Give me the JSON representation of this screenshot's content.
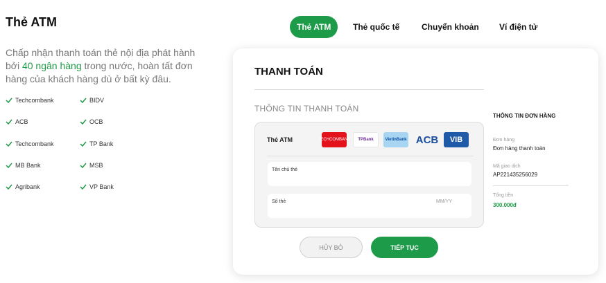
{
  "left": {
    "title": "Thẻ ATM",
    "intro_part1": "Chấp nhận thanh toán thẻ nội địa phát hành bởi ",
    "intro_highlight": "40 ngân hàng",
    "intro_part2": " trong nước, hoàn tất đơn hàng của khách hàng dù ở bất kỳ đâu.",
    "banks": [
      "Techcombank",
      "BIDV",
      "ACB",
      "OCB",
      "Techcombank",
      "TP Bank",
      "MB Bank",
      "MSB",
      "Agribank",
      "VP Bank"
    ]
  },
  "tabs": [
    "Thẻ ATM",
    "Thẻ quốc tế",
    "Chuyển khoản",
    "Ví điện tử"
  ],
  "payment": {
    "title": "THANH TOÁN",
    "info_title": "THÔNG TIN THANH TOÁN",
    "card_type_label": "Thẻ ATM",
    "bank_logos": [
      "TECHCOMBANK",
      "TPBank",
      "VietinBank",
      "ACB",
      "VIB"
    ],
    "cardholder_label": "Tên chủ thẻ",
    "card_number_label": "Số thẻ",
    "expiry_placeholder": "MM/YY",
    "cancel_label": "HỦY BỎ",
    "next_label": "TIẾP TỤC"
  },
  "order": {
    "title": "THÔNG TIN ĐƠN HÀNG",
    "order_label": "Đơn hàng",
    "order_value": "Đơn hàng thanh toán",
    "txn_label": "Mã giao dịch",
    "txn_value": "AP221435256029",
    "total_label": "Tổng tiền",
    "total_value": "300.000đ"
  },
  "colors": {
    "accent": "#1e9b48"
  }
}
